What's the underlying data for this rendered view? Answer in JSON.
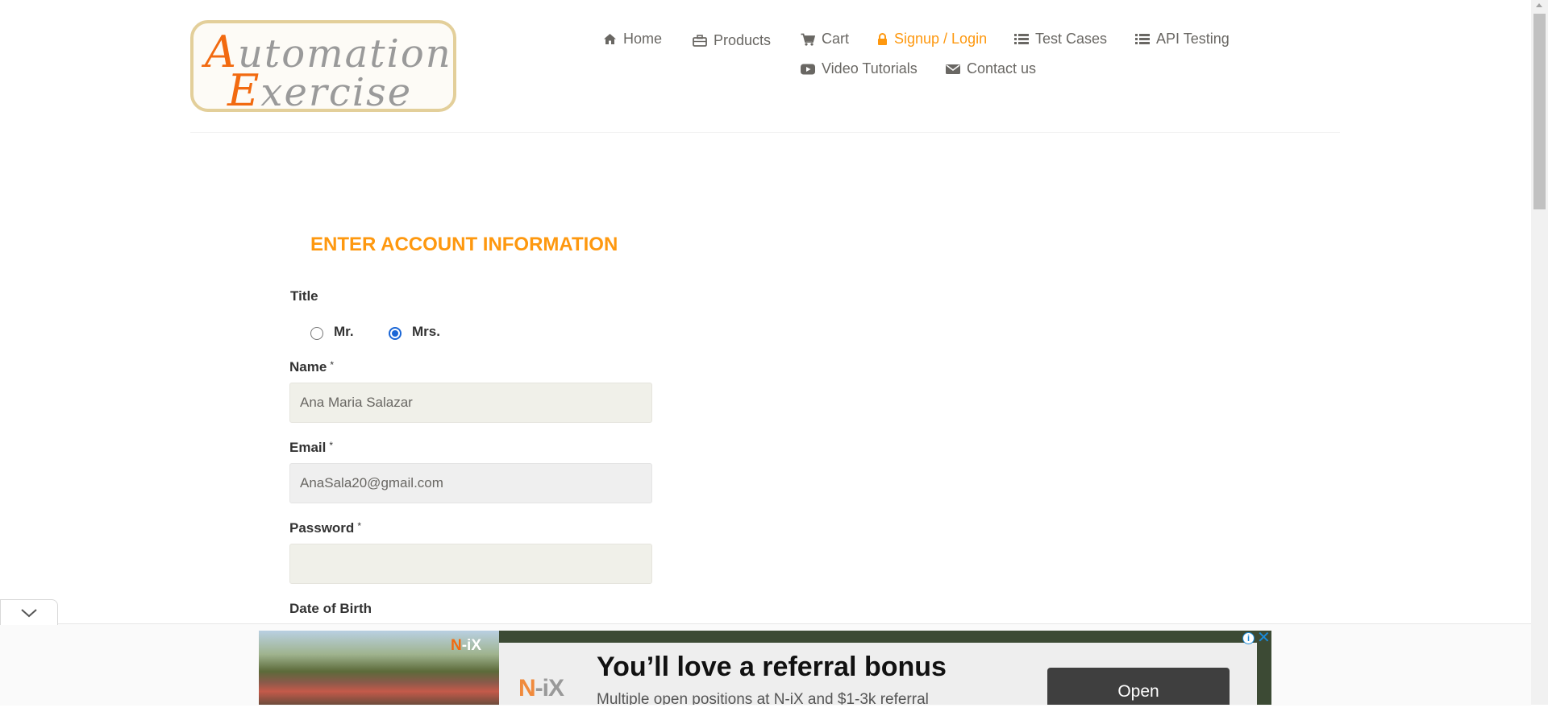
{
  "logo": {
    "line1_cap": "A",
    "line1_rest": "utomation",
    "line2_cap": "E",
    "line2_rest": "xercise"
  },
  "nav": {
    "home": "Home",
    "products": "Products",
    "cart": "Cart",
    "signup_login": "Signup / Login",
    "test_cases": "Test Cases",
    "api_testing": "API Testing",
    "video_tutorials": "Video Tutorials",
    "contact_us": "Contact us"
  },
  "form": {
    "heading": "ENTER ACCOUNT INFORMATION",
    "title_label": "Title",
    "title_options": [
      {
        "label": "Mr.",
        "checked": false
      },
      {
        "label": "Mrs.",
        "checked": true
      }
    ],
    "name_label": "Name",
    "name_value": "Ana Maria Salazar",
    "email_label": "Email",
    "email_value": "AnaSala20@gmail.com",
    "password_label": "Password",
    "password_value": "",
    "required_mark": "*",
    "dob_label": "Date of Birth"
  },
  "ad": {
    "photo_logo_n": "N",
    "photo_logo_rest": "-iX",
    "card_logo_n": "N",
    "card_logo_rest": "-iX",
    "title": "You’ll love a referral bonus",
    "subtitle": "Multiple open positions at N-iX and $1-3k referral",
    "button": "Open",
    "info_icon_text": "i",
    "close_icon_text": "✕"
  },
  "colors": {
    "accent": "#fe980f",
    "text": "#696763",
    "field_bg": "#f0f0e9",
    "radio_checked": "#1a66d6"
  }
}
